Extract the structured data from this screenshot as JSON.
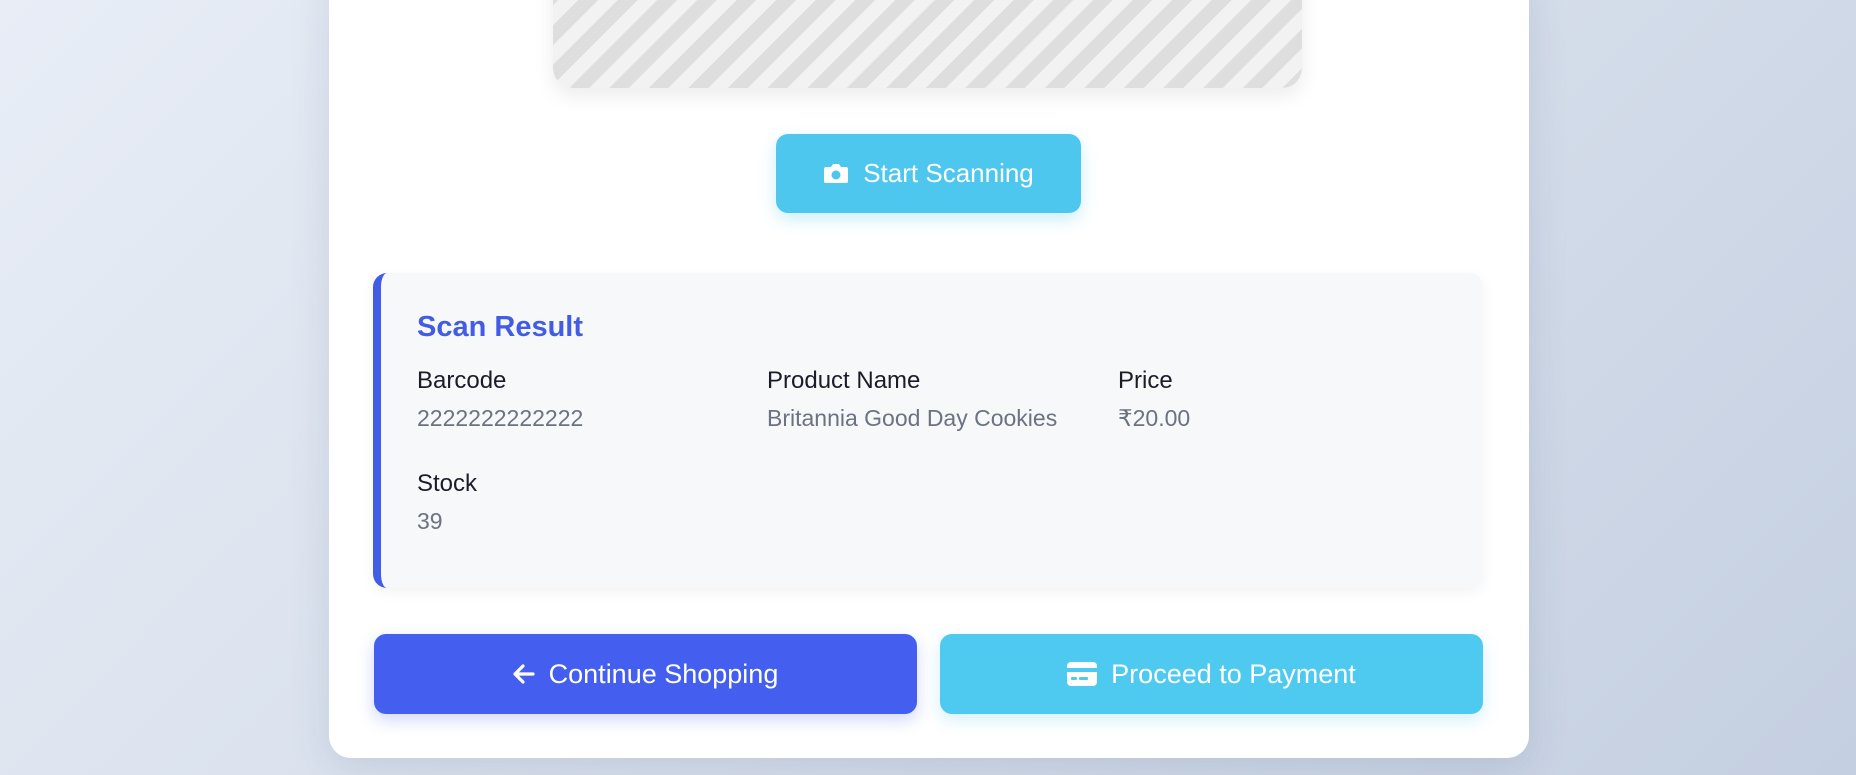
{
  "scanner": {
    "start_label": "Start Scanning",
    "icon": "camera-icon"
  },
  "result": {
    "title": "Scan Result",
    "barcode_label": "Barcode",
    "barcode_value": "2222222222222",
    "name_label": "Product Name",
    "name_value": "Britannia Good Day Cookies",
    "price_label": "Price",
    "price_value": "₹20.00",
    "stock_label": "Stock",
    "stock_value": "39"
  },
  "actions": {
    "continue_label": "Continue Shopping",
    "continue_icon": "arrow-left-icon",
    "payment_label": "Proceed to Payment",
    "payment_icon": "credit-card-icon"
  },
  "colors": {
    "primary": "#445ff0",
    "accent": "#4ec9f0",
    "result_title": "#425ce6"
  }
}
